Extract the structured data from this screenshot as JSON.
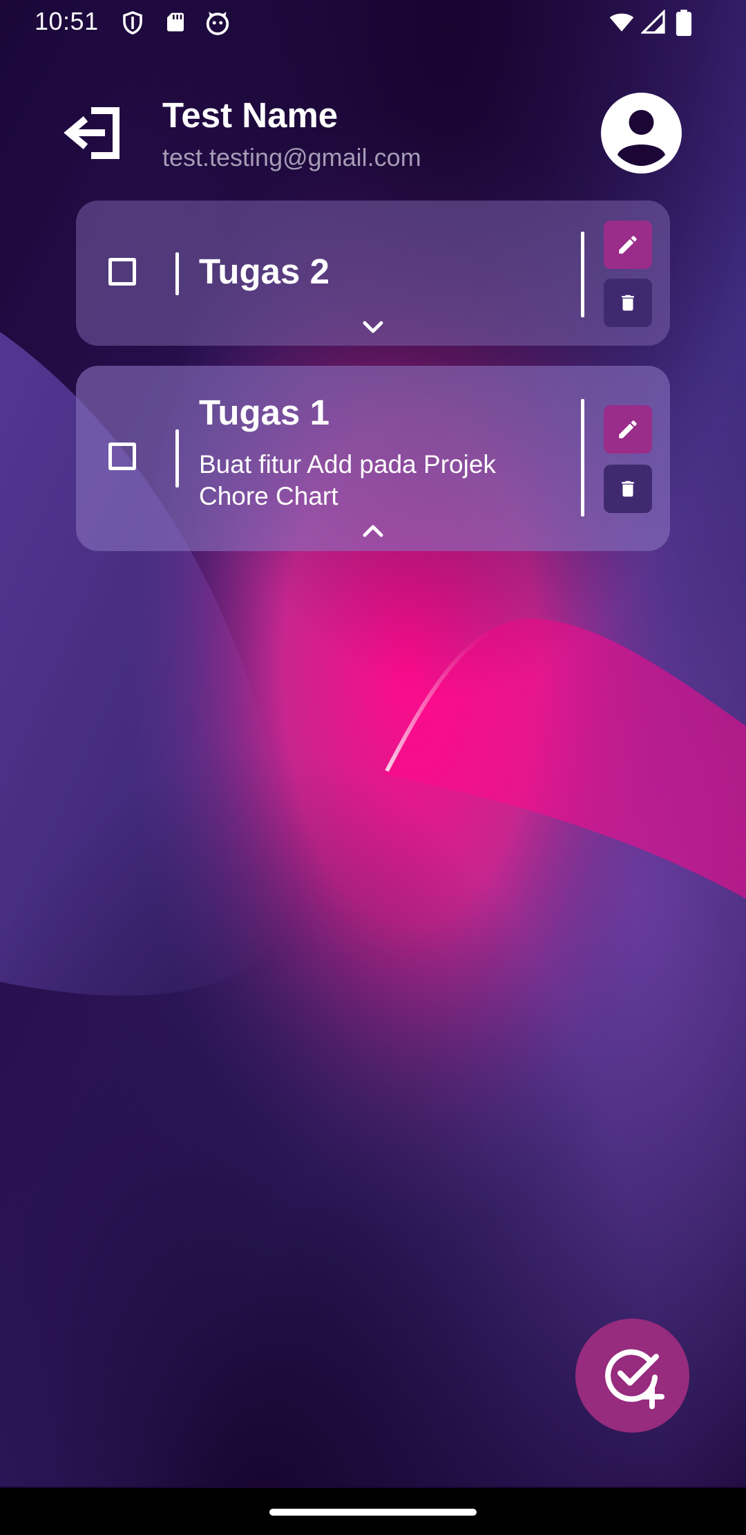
{
  "status_bar": {
    "time": "10:51",
    "left_icons": [
      "shield-icon",
      "sd-card-icon",
      "cat-icon"
    ],
    "right_icons": [
      "wifi-icon",
      "signal-icon",
      "battery-icon"
    ]
  },
  "header": {
    "logout_icon": "logout-icon",
    "name": "Test Name",
    "email": "test.testing@gmail.com",
    "avatar_icon": "account-circle-icon"
  },
  "tasks": [
    {
      "title": "Tugas 2",
      "description": "",
      "checked": false,
      "expanded": false
    },
    {
      "title": "Tugas 1",
      "description": "Buat fitur Add pada Projek Chore Chart",
      "checked": false,
      "expanded": true
    }
  ],
  "fab": {
    "icon": "add-task-icon"
  },
  "colors": {
    "background_dark": "#1b0636",
    "edit_button": "#9a2c8a",
    "delete_button": "#3f2a70",
    "fab": "#972b7e",
    "accent_pink": "#ff0a8c",
    "email_text": "#a59cb6"
  }
}
